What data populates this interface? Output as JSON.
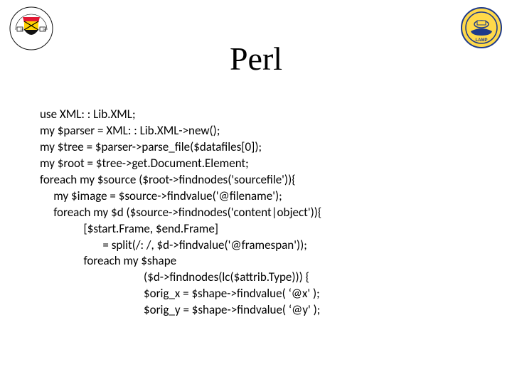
{
  "title": "Perl",
  "logo_left_name": "university-of-maryland-seal",
  "logo_right_name": "lamp-logo",
  "code": "use XML: : Lib.XML;\nmy $parser = XML: : Lib.XML->new();\nmy $tree = $parser->parse_file($datafiles[0]);\nmy $root = $tree->get.Document.Element;\nforeach my $source ($root->findnodes('sourcefile')){\n     my $image = $source->findvalue('@filename');\n     foreach my $d ($source->findnodes('content|object')){\n                [$start.Frame, $end.Frame]\n                       = split(/: /, $d->findvalue('@framespan'));\n                foreach my $shape\n                                      ($d->findnodes(lc($attrib.Type))) {\n                                      $orig_x = $shape->findvalue( ‘@x' );\n                                      $orig_y = $shape->findvalue( ‘@y' );"
}
